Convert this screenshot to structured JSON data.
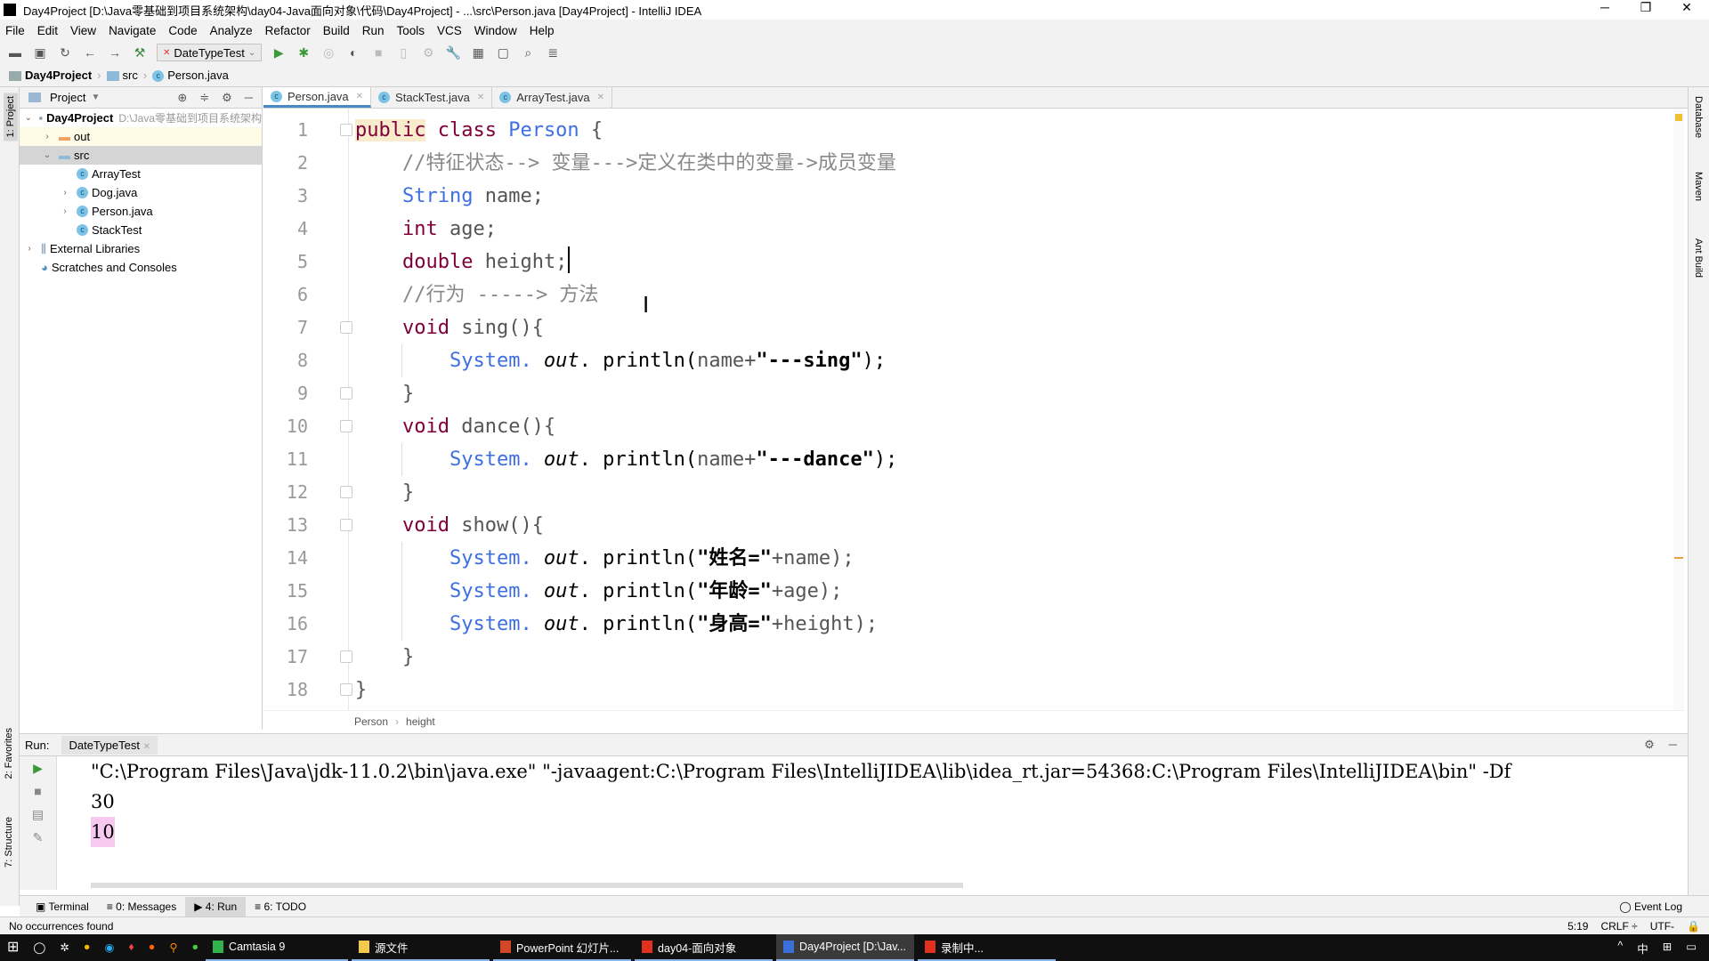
{
  "window": {
    "title": "Day4Project [D:\\Java零基础到项目系统架构\\day04-Java面向对象\\代码\\Day4Project] - ...\\src\\Person.java [Day4Project] - IntelliJ IDEA",
    "minimize": "─",
    "maximize": "❐",
    "close": "✕"
  },
  "menu": [
    "File",
    "Edit",
    "View",
    "Navigate",
    "Code",
    "Analyze",
    "Refactor",
    "Build",
    "Run",
    "Tools",
    "VCS",
    "Window",
    "Help"
  ],
  "toolbar": {
    "run_config": "DateTypeTest"
  },
  "navbar": {
    "crumbs": [
      "Day4Project",
      "src",
      "Person.java"
    ]
  },
  "left_stripe": {
    "project": "1: Project",
    "favorites": "2: Favorites",
    "structure": "7: Structure"
  },
  "project_panel": {
    "title": "Project",
    "tree": [
      {
        "label": "Day4Project",
        "path": "D:\\Java零基础到项目系统架构",
        "depth": 0,
        "arrow": "⌄",
        "icon": "module",
        "bold": true
      },
      {
        "label": "out",
        "depth": 1,
        "arrow": "›",
        "icon": "folder-orange"
      },
      {
        "label": "src",
        "depth": 1,
        "arrow": "⌄",
        "icon": "folder-blue",
        "selected": true
      },
      {
        "label": "ArrayTest",
        "depth": 2,
        "arrow": "",
        "icon": "class-run"
      },
      {
        "label": "Dog.java",
        "depth": 2,
        "arrow": "›",
        "icon": "class"
      },
      {
        "label": "Person.java",
        "depth": 2,
        "arrow": "›",
        "icon": "class"
      },
      {
        "label": "StackTest",
        "depth": 2,
        "arrow": "",
        "icon": "class-run"
      },
      {
        "label": "External Libraries",
        "depth": 0,
        "arrow": "›",
        "icon": "libraries"
      },
      {
        "label": "Scratches and Consoles",
        "depth": 0,
        "arrow": "",
        "icon": "scratches"
      }
    ]
  },
  "tabs": [
    {
      "label": "Person.java",
      "active": true
    },
    {
      "label": "StackTest.java"
    },
    {
      "label": "ArrayTest.java"
    }
  ],
  "editor": {
    "lines": [
      [
        [
          "public",
          "kw hl"
        ],
        [
          " class ",
          "kw"
        ],
        [
          "Person",
          "cls"
        ],
        [
          " {",
          "id"
        ]
      ],
      [
        [
          "    //特征状态--> 变量--->定义在类中的变量->成员变量",
          "cm"
        ]
      ],
      [
        [
          "    "
        ],
        [
          "String",
          "cls"
        ],
        [
          " name;",
          "id"
        ]
      ],
      [
        [
          "    "
        ],
        [
          "int",
          "kw"
        ],
        [
          " age;",
          "id"
        ]
      ],
      [
        [
          "    "
        ],
        [
          "double",
          "kw"
        ],
        [
          " height;",
          "id"
        ]
      ],
      [
        [
          "    //行为 -----> 方法",
          "cm"
        ]
      ],
      [
        [
          "    "
        ],
        [
          "void",
          "kw"
        ],
        [
          " sing(){",
          "id"
        ]
      ],
      [
        [
          "        "
        ],
        [
          "System.",
          "cls"
        ],
        [
          " out",
          "fld"
        ],
        [
          ". println(",
          "pl"
        ],
        [
          "name+",
          "id"
        ],
        [
          "\"---sing\"",
          "st"
        ],
        [
          ");",
          "pl"
        ]
      ],
      [
        [
          "    }",
          "id"
        ]
      ],
      [
        [
          "    "
        ],
        [
          "void",
          "kw"
        ],
        [
          " dance(){",
          "id"
        ]
      ],
      [
        [
          "        "
        ],
        [
          "System.",
          "cls"
        ],
        [
          " out",
          "fld"
        ],
        [
          ". println(",
          "pl"
        ],
        [
          "name+",
          "id"
        ],
        [
          "\"---dance\"",
          "st"
        ],
        [
          ");",
          "pl"
        ]
      ],
      [
        [
          "    }",
          "id"
        ]
      ],
      [
        [
          "    "
        ],
        [
          "void",
          "kw"
        ],
        [
          " show(){",
          "id"
        ]
      ],
      [
        [
          "        "
        ],
        [
          "System.",
          "cls"
        ],
        [
          " out",
          "fld"
        ],
        [
          ". println(",
          "pl"
        ],
        [
          "\"姓名=\"",
          "st"
        ],
        [
          "+name);",
          "id"
        ]
      ],
      [
        [
          "        "
        ],
        [
          "System.",
          "cls"
        ],
        [
          " out",
          "fld"
        ],
        [
          ". println(",
          "pl"
        ],
        [
          "\"年龄=\"",
          "st"
        ],
        [
          "+age);",
          "id"
        ]
      ],
      [
        [
          "        "
        ],
        [
          "System.",
          "cls"
        ],
        [
          " out",
          "fld"
        ],
        [
          ". println(",
          "pl"
        ],
        [
          "\"身高=\"",
          "st"
        ],
        [
          "+height);",
          "id"
        ]
      ],
      [
        [
          "    }",
          "id"
        ]
      ],
      [
        [
          "}",
          "id"
        ]
      ]
    ],
    "line_numbers": [
      "1",
      "2",
      "3",
      "4",
      "5",
      "6",
      "7",
      "8",
      "9",
      "10",
      "11",
      "12",
      "13",
      "14",
      "15",
      "16",
      "17",
      "18"
    ],
    "breadcrumb": [
      "Person",
      "height"
    ]
  },
  "right_stripe": [
    "Database",
    "Maven",
    "Ant Build"
  ],
  "run": {
    "label": "Run:",
    "tab": "DateTypeTest",
    "output": [
      "\"C:\\Program Files\\Java\\jdk-11.0.2\\bin\\java.exe\" \"-javaagent:C:\\Program Files\\IntelliJIDEA\\lib\\idea_rt.jar=54368:C:\\Program Files\\IntelliJIDEA\\bin\" -Df",
      "30",
      "10"
    ]
  },
  "bottom_tabs": [
    "Terminal",
    "0: Messages",
    "4: Run",
    "6: TODO"
  ],
  "event_log": "Event Log",
  "status": {
    "message": "No occurrences found",
    "position": "5:19",
    "line_sep": "CRLF ÷",
    "encoding": "UTF-"
  },
  "taskbar": {
    "items": [
      {
        "label": "Camtasia 9",
        "color": "#2fb34a"
      },
      {
        "label": "源文件",
        "color": "#f2c94c"
      },
      {
        "label": "PowerPoint 幻灯片...",
        "color": "#d24726"
      },
      {
        "label": "day04-面向对象",
        "color": "#e0301e"
      },
      {
        "label": "Day4Project [D:\\Jav...",
        "color": "#3a6fd8",
        "active": true
      },
      {
        "label": "录制中...",
        "color": "#e0301e"
      }
    ],
    "tray": [
      "^",
      "中",
      "⊞",
      "▭"
    ]
  }
}
